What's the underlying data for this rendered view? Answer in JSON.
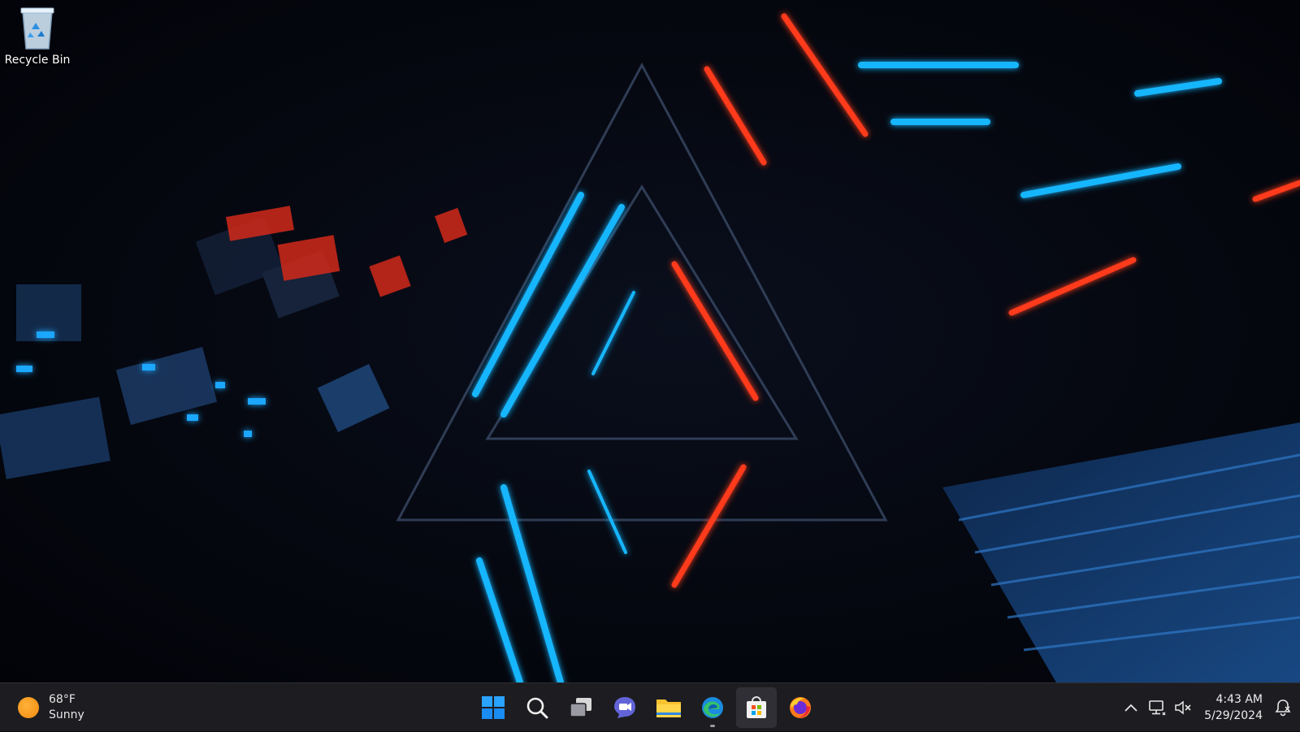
{
  "desktop": {
    "icons": [
      {
        "label": "Recycle Bin",
        "icon": "recycle-bin-icon"
      }
    ]
  },
  "taskbar": {
    "weather": {
      "temperature": "68°F",
      "condition": "Sunny",
      "icon": "sun-icon"
    },
    "apps": [
      {
        "name": "Start",
        "icon": "windows-logo-icon"
      },
      {
        "name": "Search",
        "icon": "search-icon"
      },
      {
        "name": "Task View",
        "icon": "task-view-icon"
      },
      {
        "name": "Chat",
        "icon": "chat-icon"
      },
      {
        "name": "File Explorer",
        "icon": "folder-icon"
      },
      {
        "name": "Microsoft Edge",
        "icon": "edge-icon",
        "running": true
      },
      {
        "name": "Microsoft Store",
        "icon": "store-icon"
      },
      {
        "name": "Firefox",
        "icon": "firefox-icon"
      }
    ],
    "tray": {
      "overflow_icon": "chevron-up-icon",
      "network_icon": "network-icon",
      "volume_icon": "volume-muted-icon",
      "time": "4:43 AM",
      "date": "5/29/2024",
      "notification_icon": "notification-bell-icon"
    }
  },
  "colors": {
    "taskbar_bg": "#1d1d21",
    "neon_blue": "#17b6ff",
    "neon_red": "#ff3a1a",
    "start_blue": "#1e90ff"
  }
}
